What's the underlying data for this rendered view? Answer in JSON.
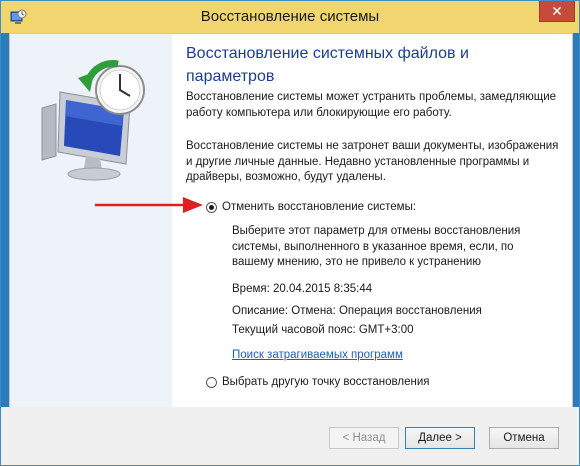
{
  "window": {
    "title": "Восстановление системы",
    "close_label": "✕",
    "title_icon": "system-restore-icon"
  },
  "main": {
    "heading": "Восстановление системных файлов и параметров",
    "para1": "Восстановление системы может устранить проблемы, замедляющие работу компьютера или блокирующие его работу.",
    "para2": "Восстановление системы не затронет ваши документы, изображения и другие личные данные. Недавно установленные программы и драйверы, возможно, будут удалены.",
    "option_undo": {
      "label": "Отменить восстановление системы:",
      "selected": true,
      "description": "Выберите этот параметр для отмены восстановления системы, выполненного в указанное время, если, по вашему мнению, это не привело к устранению",
      "time": "Время: 20.04.2015 8:35:44",
      "desc": "Описание: Отмена: Операция восстановления",
      "timezone": "Текущий часовой пояс: GMT+3:00",
      "link": "Поиск затрагиваемых программ"
    },
    "option_other": {
      "label": "Выбрать другую точку восстановления",
      "selected": false
    }
  },
  "buttons": {
    "back": "< Назад",
    "next": "Далее >",
    "cancel": "Отмена"
  },
  "colors": {
    "titlebar": "#f1d56e",
    "heading": "#1b3f8f",
    "link": "#1a5fbf",
    "arrow": "#e02020"
  }
}
